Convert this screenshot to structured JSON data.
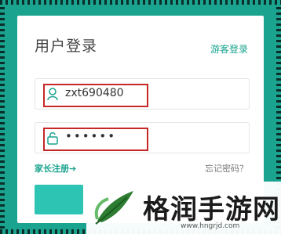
{
  "login": {
    "title": "用户登录",
    "guest_link": "游客登录",
    "username_value": "zxt690480",
    "password_value": "••••••",
    "register_link": "家长注册➔",
    "forgot_link": "忘记密码？"
  },
  "watermark": {
    "brand": "格润手游网",
    "site": "www.hngrjd.com"
  },
  "colors": {
    "accent": "#1aa38f",
    "highlight": "#c62828",
    "button": "#2ec4b4"
  }
}
